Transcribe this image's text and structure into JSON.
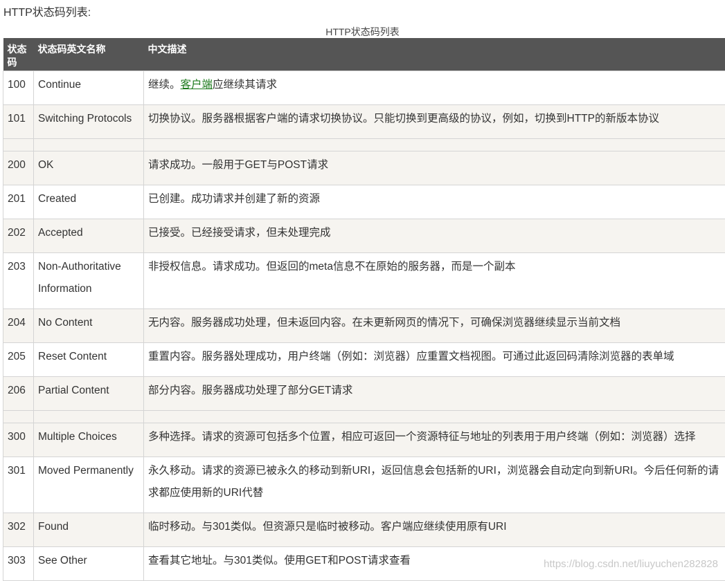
{
  "page": {
    "heading": "HTTP状态码列表:",
    "caption": "HTTP状态码列表",
    "watermark": "https://blog.csdn.net/liuyuchen282828"
  },
  "table": {
    "headers": [
      "状态码",
      "状态码英文名称",
      "中文描述"
    ],
    "rows": [
      {
        "code": "100",
        "name": "Continue",
        "desc_pre": "继续。",
        "desc_link": "客户端",
        "desc_post": "应继续其请求"
      },
      {
        "code": "101",
        "name": "Switching Protocols",
        "desc": "切换协议。服务器根据客户端的请求切换协议。只能切换到更高级的协议，例如，切换到HTTP的新版本协议"
      },
      {
        "code": "200",
        "name": "OK",
        "desc": "请求成功。一般用于GET与POST请求"
      },
      {
        "code": "201",
        "name": "Created",
        "desc": "已创建。成功请求并创建了新的资源"
      },
      {
        "code": "202",
        "name": "Accepted",
        "desc": "已接受。已经接受请求，但未处理完成"
      },
      {
        "code": "203",
        "name": "Non-Authoritative Information",
        "desc": "非授权信息。请求成功。但返回的meta信息不在原始的服务器，而是一个副本"
      },
      {
        "code": "204",
        "name": "No Content",
        "desc": "无内容。服务器成功处理，但未返回内容。在未更新网页的情况下，可确保浏览器继续显示当前文档"
      },
      {
        "code": "205",
        "name": "Reset Content",
        "desc": "重置内容。服务器处理成功，用户终端（例如：浏览器）应重置文档视图。可通过此返回码清除浏览器的表单域"
      },
      {
        "code": "206",
        "name": "Partial Content",
        "desc": "部分内容。服务器成功处理了部分GET请求"
      },
      {
        "code": "300",
        "name": "Multiple Choices",
        "desc": "多种选择。请求的资源可包括多个位置，相应可返回一个资源特征与地址的列表用于用户终端（例如：浏览器）选择"
      },
      {
        "code": "301",
        "name": "Moved Permanently",
        "desc": "永久移动。请求的资源已被永久的移动到新URI，返回信息会包括新的URI，浏览器会自动定向到新URI。今后任何新的请求都应使用新的URI代替"
      },
      {
        "code": "302",
        "name": "Found",
        "desc": "临时移动。与301类似。但资源只是临时被移动。客户端应继续使用原有URI"
      },
      {
        "code": "303",
        "name": "See Other",
        "desc": "查看其它地址。与301类似。使用GET和POST请求查看"
      }
    ]
  }
}
